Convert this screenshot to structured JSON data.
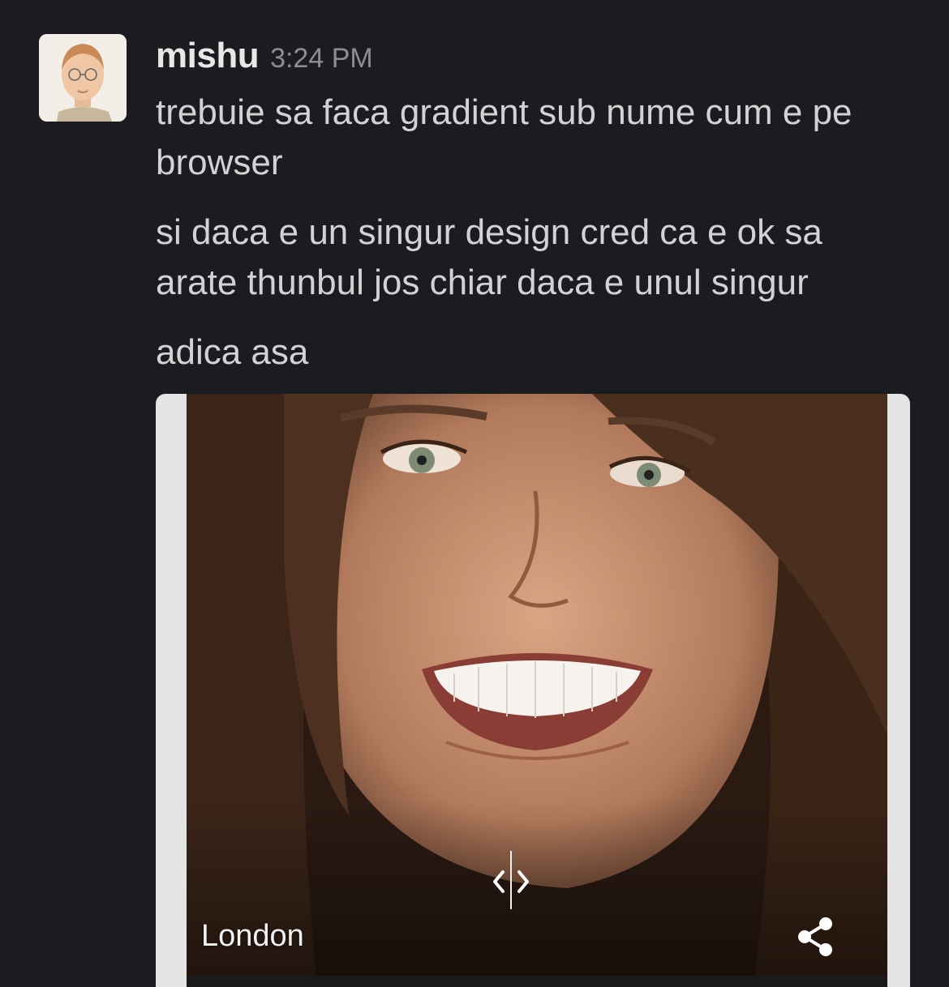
{
  "message": {
    "username": "mishu",
    "timestamp": "3:24 PM",
    "lines": [
      "trebuie sa faca gradient sub nume cum e pe browser",
      "si daca e un singur design cred ca e ok sa arate thunbul jos chiar daca e unul singur",
      "adica asa"
    ]
  },
  "attachment": {
    "caption": "London",
    "icons": [
      "chevron-left-icon",
      "chevron-right-icon",
      "share-icon"
    ]
  }
}
